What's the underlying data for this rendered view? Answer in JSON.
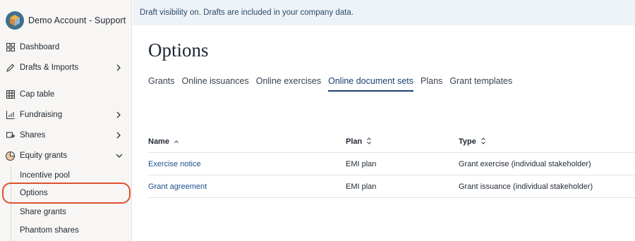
{
  "sidebar": {
    "account_name": "Demo Account - Support",
    "items": [
      {
        "label": "Dashboard",
        "icon": "dashboard-icon"
      },
      {
        "label": "Drafts & Imports",
        "icon": "pencil-icon",
        "expandable": true
      },
      {
        "label": "Cap table",
        "icon": "table-icon"
      },
      {
        "label": "Fundraising",
        "icon": "chart-icon",
        "expandable": true
      },
      {
        "label": "Shares",
        "icon": "shares-icon",
        "expandable": true
      },
      {
        "label": "Equity grants",
        "icon": "pie-icon",
        "expanded": true
      }
    ],
    "subitems": [
      {
        "label": "Incentive pool"
      },
      {
        "label": "Options",
        "selected": true
      },
      {
        "label": "Share grants"
      },
      {
        "label": "Phantom shares"
      }
    ]
  },
  "banner": {
    "text": "Draft visibility on. Drafts are included in your company data."
  },
  "page": {
    "title": "Options"
  },
  "tabs": [
    {
      "label": "Grants"
    },
    {
      "label": "Online issuances"
    },
    {
      "label": "Online exercises"
    },
    {
      "label": "Online document sets",
      "active": true
    },
    {
      "label": "Plans"
    },
    {
      "label": "Grant templates"
    }
  ],
  "table": {
    "columns": [
      "Name",
      "Plan",
      "Type"
    ],
    "rows": [
      {
        "name": "Exercise notice",
        "plan": "EMI plan",
        "type": "Grant exercise (individual stakeholder)"
      },
      {
        "name": "Grant agreement",
        "plan": "EMI plan",
        "type": "Grant issuance (individual stakeholder)"
      }
    ]
  },
  "colors": {
    "accent": "#1d3f73",
    "highlight": "#e0502f",
    "banner_bg": "#eef3f8"
  }
}
